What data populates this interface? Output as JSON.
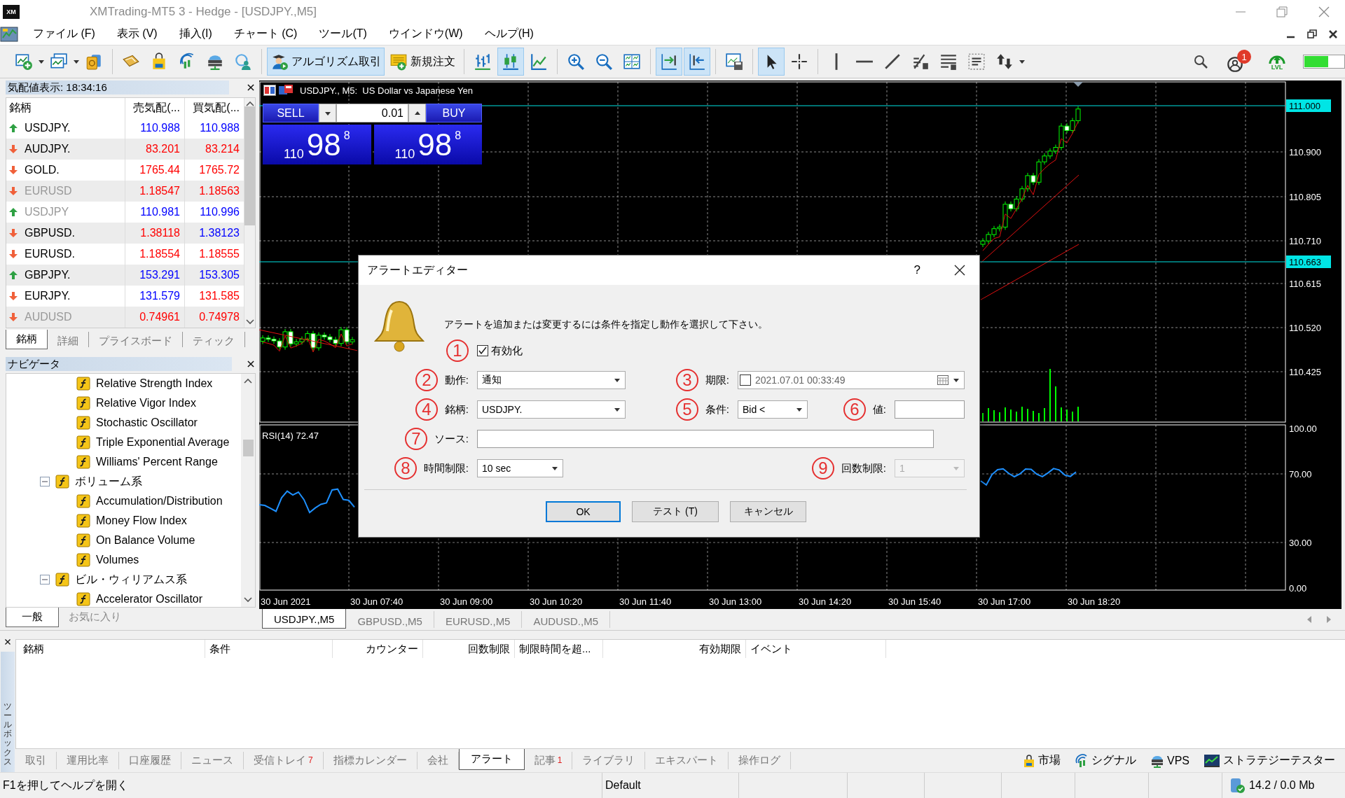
{
  "window": {
    "logo": "XM",
    "title": "XMTrading-MT5 3 - Hedge - [USDJPY.,M5]"
  },
  "menu": [
    "ファイル (F)",
    "表示 (V)",
    "挿入(I)",
    "チャート (C)",
    "ツール(T)",
    "ウインドウ(W)",
    "ヘルプ(H)"
  ],
  "toolbar": {
    "groups": [
      [
        {
          "selected": false,
          "dropdown": true
        },
        {
          "selected": false,
          "dropdown": true
        },
        {
          "selected": false
        }
      ],
      [
        {
          "selected": false
        },
        {
          "selected": false
        },
        {
          "selected": false
        },
        {
          "selected": false
        },
        {
          "selected": false
        }
      ],
      [
        {
          "selected": true,
          "label": "アルゴリズム取引"
        },
        {
          "selected": false,
          "label": "新規注文"
        }
      ],
      [
        {
          "selected": false
        },
        {
          "selected": true
        },
        {
          "selected": false
        }
      ],
      [
        {
          "selected": false
        },
        {
          "selected": false
        },
        {
          "selected": false
        }
      ],
      [
        {
          "selected": true
        },
        {
          "selected": true
        }
      ],
      [
        {
          "selected": false
        }
      ],
      [
        {
          "selected": true
        },
        {
          "selected": false
        }
      ],
      [
        {
          "selected": false
        },
        {
          "selected": false
        },
        {
          "selected": false
        },
        {
          "selected": false
        },
        {
          "selected": false
        },
        {
          "selected": false
        },
        {
          "selected": false,
          "dropdown": true
        }
      ]
    ],
    "notification_count": "1",
    "level_label": "LVL"
  },
  "market_watch": {
    "title": "気配値表示: 18:34:16",
    "columns": [
      "銘柄",
      "売気配(...",
      "買気配(..."
    ],
    "rows": [
      {
        "symbol": "USDJPY.",
        "up": true,
        "dimmed": false,
        "bid": {
          "text": "110.988",
          "color": "#0000ff"
        },
        "ask": {
          "text": "110.988",
          "color": "#0000ff"
        }
      },
      {
        "symbol": "AUDJPY.",
        "up": false,
        "dimmed": false,
        "bid": {
          "text": "83.201",
          "color": "#ff0000"
        },
        "ask": {
          "text": "83.214",
          "color": "#ff0000"
        }
      },
      {
        "symbol": "GOLD.",
        "up": false,
        "dimmed": false,
        "bid": {
          "text": "1765.44",
          "color": "#ff0000"
        },
        "ask": {
          "text": "1765.72",
          "color": "#ff0000"
        }
      },
      {
        "symbol": "EURUSD",
        "up": false,
        "dimmed": true,
        "bid": {
          "text": "1.18547",
          "color": "#ff0000"
        },
        "ask": {
          "text": "1.18563",
          "color": "#ff0000"
        }
      },
      {
        "symbol": "USDJPY",
        "up": true,
        "dimmed": true,
        "bid": {
          "text": "110.981",
          "color": "#0000ff"
        },
        "ask": {
          "text": "110.996",
          "color": "#0000ff"
        }
      },
      {
        "symbol": "GBPUSD.",
        "up": false,
        "dimmed": false,
        "bid": {
          "text": "1.38118",
          "color": "#ff0000"
        },
        "ask": {
          "text": "1.38123",
          "color": "#0000ff"
        }
      },
      {
        "symbol": "EURUSD.",
        "up": false,
        "dimmed": false,
        "bid": {
          "text": "1.18554",
          "color": "#ff0000"
        },
        "ask": {
          "text": "1.18555",
          "color": "#ff0000"
        }
      },
      {
        "symbol": "GBPJPY.",
        "up": true,
        "dimmed": false,
        "bid": {
          "text": "153.291",
          "color": "#0000ff"
        },
        "ask": {
          "text": "153.305",
          "color": "#0000ff"
        }
      },
      {
        "symbol": "EURJPY.",
        "up": false,
        "dimmed": false,
        "bid": {
          "text": "131.579",
          "color": "#0000ff"
        },
        "ask": {
          "text": "131.585",
          "color": "#ff0000"
        }
      },
      {
        "symbol": "AUDUSD",
        "up": false,
        "dimmed": true,
        "bid": {
          "text": "0.74961",
          "color": "#ff0000"
        },
        "ask": {
          "text": "0.74978",
          "color": "#ff0000"
        }
      }
    ],
    "tabs": [
      {
        "label": "銘柄",
        "selected": true
      },
      {
        "label": "詳細",
        "selected": false
      },
      {
        "label": "プライスボード",
        "selected": false
      },
      {
        "label": "ティック",
        "selected": false
      }
    ]
  },
  "navigator": {
    "title": "ナビゲータ",
    "tree": [
      {
        "children": [
          {
            "children": [
              {
                "label": "Relative Strength Index"
              },
              {
                "label": "Relative Vigor Index"
              },
              {
                "label": "Stochastic Oscillator"
              },
              {
                "label": "Triple Exponential Average"
              },
              {
                "label": "Williams' Percent Range"
              }
            ]
          },
          {
            "label": "ボリューム系",
            "expanded": true,
            "children": [
              {
                "label": "Accumulation/Distribution"
              },
              {
                "label": "Money Flow Index"
              },
              {
                "label": "On Balance Volume"
              },
              {
                "label": "Volumes"
              }
            ]
          },
          {
            "label": "ビル・ウィリアムス系",
            "expanded": true,
            "children": [
              {
                "label": "Accelerator Oscillator"
              }
            ]
          }
        ]
      }
    ],
    "tabs": [
      {
        "label": "一般",
        "selected": true
      },
      {
        "label": "お気に入り",
        "selected": false
      }
    ]
  },
  "chart": {
    "title": "USDJPY., M5:  US Dollar vs Japanese Yen",
    "one_click": {
      "sell": "SELL",
      "buy": "BUY",
      "lot": "0.01",
      "sell_price": {
        "prefix": "110",
        "main": "98",
        "suffix": "8"
      },
      "buy_price": {
        "prefix": "110",
        "main": "98",
        "suffix": "8"
      }
    },
    "price_labels": [
      {
        "text": "111.000",
        "highlighted": true
      },
      {
        "text": "110.900",
        "highlighted": false
      },
      {
        "text": "110.805",
        "highlighted": false
      },
      {
        "text": "110.710",
        "highlighted": false
      },
      {
        "text": "110.663",
        "highlighted": true
      },
      {
        "text": "110.615",
        "highlighted": false
      },
      {
        "text": "110.520",
        "highlighted": false
      },
      {
        "text": "110.425",
        "highlighted": false
      }
    ],
    "indicator_title": "RSI(14) 72.47",
    "indicator_labels": [
      "100.00",
      "70.00",
      "30.00",
      "0.00"
    ],
    "time_labels": [
      "30 Jun 2021",
      "30 Jun 07:40",
      "30 Jun 09:00",
      "30 Jun 10:20",
      "30 Jun 11:40",
      "30 Jun 13:00",
      "30 Jun 14:20",
      "30 Jun 15:40",
      "30 Jun 17:00",
      "30 Jun 18:20"
    ],
    "tabs": [
      {
        "label": "USDJPY.,M5",
        "selected": true
      },
      {
        "label": "GBPUSD.,M5",
        "selected": false
      },
      {
        "label": "EURUSD.,M5",
        "selected": false
      },
      {
        "label": "AUDUSD.,M5",
        "selected": false
      }
    ]
  },
  "alert_dialog": {
    "title": "アラートエディター",
    "help": "?",
    "message": "アラートを追加または変更するには条件を指定し動作を選択して下さい。",
    "enable": {
      "marker": "1",
      "label": "有効化",
      "checked": true
    },
    "action": {
      "marker": "2",
      "label": "動作:",
      "value": "通知"
    },
    "expiry": {
      "marker": "3",
      "label": "期限:",
      "value": "2021.07.01 00:33:49",
      "checked": false
    },
    "symbol": {
      "marker": "4",
      "label": "銘柄:",
      "value": "USDJPY."
    },
    "condition": {
      "marker": "5",
      "label": "条件:",
      "value": "Bid <"
    },
    "value": {
      "marker": "6",
      "label": "値:"
    },
    "source": {
      "marker": "7",
      "label": "ソース:"
    },
    "timeout": {
      "marker": "8",
      "label": "時間制限:",
      "value": "10 sec"
    },
    "max_count": {
      "marker": "9",
      "label": "回数制限:",
      "value": "1",
      "disabled": true
    },
    "buttons": [
      {
        "label": "OK",
        "default": true
      },
      {
        "label": "テスト (T)",
        "default": false
      },
      {
        "label": "キャンセル",
        "default": false
      }
    ]
  },
  "toolbox": {
    "side_label": "ツールボックス",
    "columns": [
      "銘柄",
      "条件",
      "カウンター",
      "回数制限",
      "制限時間を超...",
      "有効期限",
      "イベント"
    ],
    "tabs": [
      {
        "label": "取引",
        "selected": false
      },
      {
        "label": "運用比率",
        "selected": false
      },
      {
        "label": "口座履歴",
        "selected": false
      },
      {
        "label": "ニュース",
        "selected": false
      },
      {
        "label": "受信トレイ",
        "count": "7",
        "selected": false
      },
      {
        "label": "指標カレンダー",
        "selected": false
      },
      {
        "label": "会社",
        "selected": false
      },
      {
        "label": "アラート",
        "selected": true
      },
      {
        "label": "記事",
        "count": "1",
        "selected": false
      },
      {
        "label": "ライブラリ",
        "selected": false
      },
      {
        "label": "エキスパート",
        "selected": false
      },
      {
        "label": "操作ログ",
        "selected": false
      }
    ],
    "links": [
      "市場",
      "シグナル",
      "VPS",
      "ストラテジーテスター"
    ]
  },
  "status_bar": {
    "help": "F1を押してヘルプを開く",
    "profile": "Default",
    "memory": "14.2 / 0.0 Mb"
  }
}
